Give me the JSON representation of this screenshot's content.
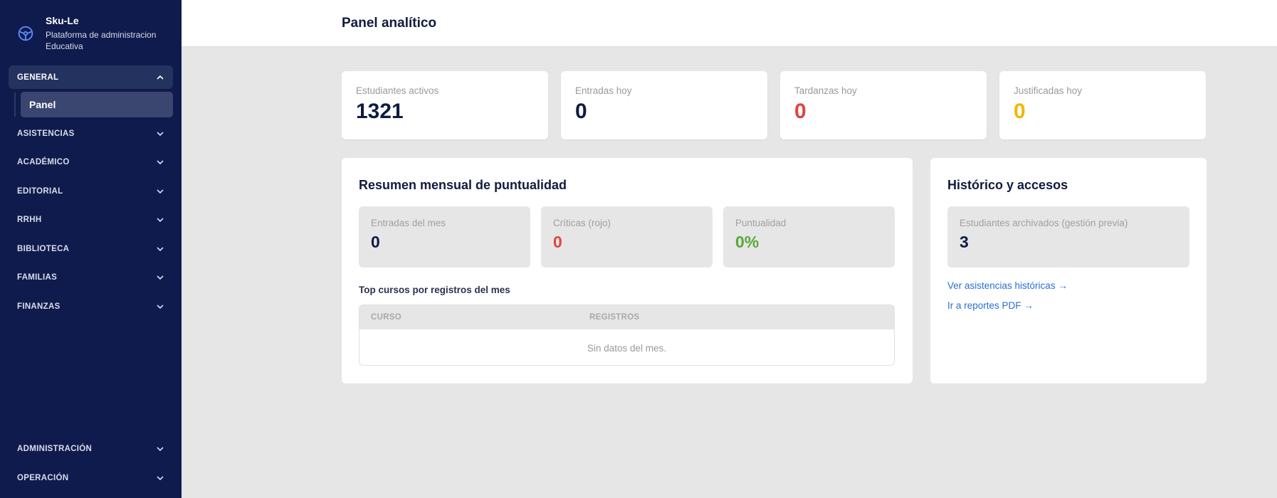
{
  "brand": {
    "name": "Sku-Le",
    "subtitle": "Plataforma de administracion Educativa",
    "icon": "steering-wheel-icon"
  },
  "sidebar": {
    "sections": [
      {
        "label": "GENERAL",
        "expanded": true,
        "items": [
          {
            "label": "Panel",
            "active": true
          }
        ]
      },
      {
        "label": "ASISTENCIAS",
        "expanded": false
      },
      {
        "label": "ACADÉMICO",
        "expanded": false
      },
      {
        "label": "EDITORIAL",
        "expanded": false
      },
      {
        "label": "RRHH",
        "expanded": false
      },
      {
        "label": "BIBLIOTECA",
        "expanded": false
      },
      {
        "label": "FAMILIAS",
        "expanded": false
      },
      {
        "label": "FINANZAS",
        "expanded": false
      },
      {
        "label": "ADMINISTRACIÓN",
        "expanded": false
      },
      {
        "label": "OPERACIÓN",
        "expanded": false
      }
    ]
  },
  "header": {
    "title": "Panel analítico"
  },
  "stats": [
    {
      "label": "Estudiantes activos",
      "value": "1321",
      "color": "#0f1b45"
    },
    {
      "label": "Entradas hoy",
      "value": "0",
      "color": "#0f1b45"
    },
    {
      "label": "Tardanzas hoy",
      "value": "0",
      "color": "#e0453a"
    },
    {
      "label": "Justificadas hoy",
      "value": "0",
      "color": "#f2b705"
    }
  ],
  "monthly": {
    "title": "Resumen mensual de puntualidad",
    "metrics": [
      {
        "label": "Entradas del mes",
        "value": "0",
        "color": "#0f1b45"
      },
      {
        "label": "Críticas (rojo)",
        "value": "0",
        "color": "#e0453a"
      },
      {
        "label": "Puntualidad",
        "value": "0%",
        "color": "#5aa63a"
      }
    ],
    "top_courses": {
      "title": "Top cursos por registros del mes",
      "columns": [
        "CURSO",
        "REGISTROS"
      ],
      "empty_text": "Sin datos del mes."
    }
  },
  "history": {
    "title": "Histórico y accesos",
    "metric": {
      "label": "Estudiantes archivados (gestión previa)",
      "value": "3"
    },
    "links": [
      "Ver asistencias históricas →",
      "Ir a reportes PDF →"
    ]
  },
  "colors": {
    "sidebar": "#0f1b4c",
    "link": "#2a6ed6",
    "danger": "#e0453a",
    "warning": "#f2b705",
    "success": "#5aa63a"
  }
}
